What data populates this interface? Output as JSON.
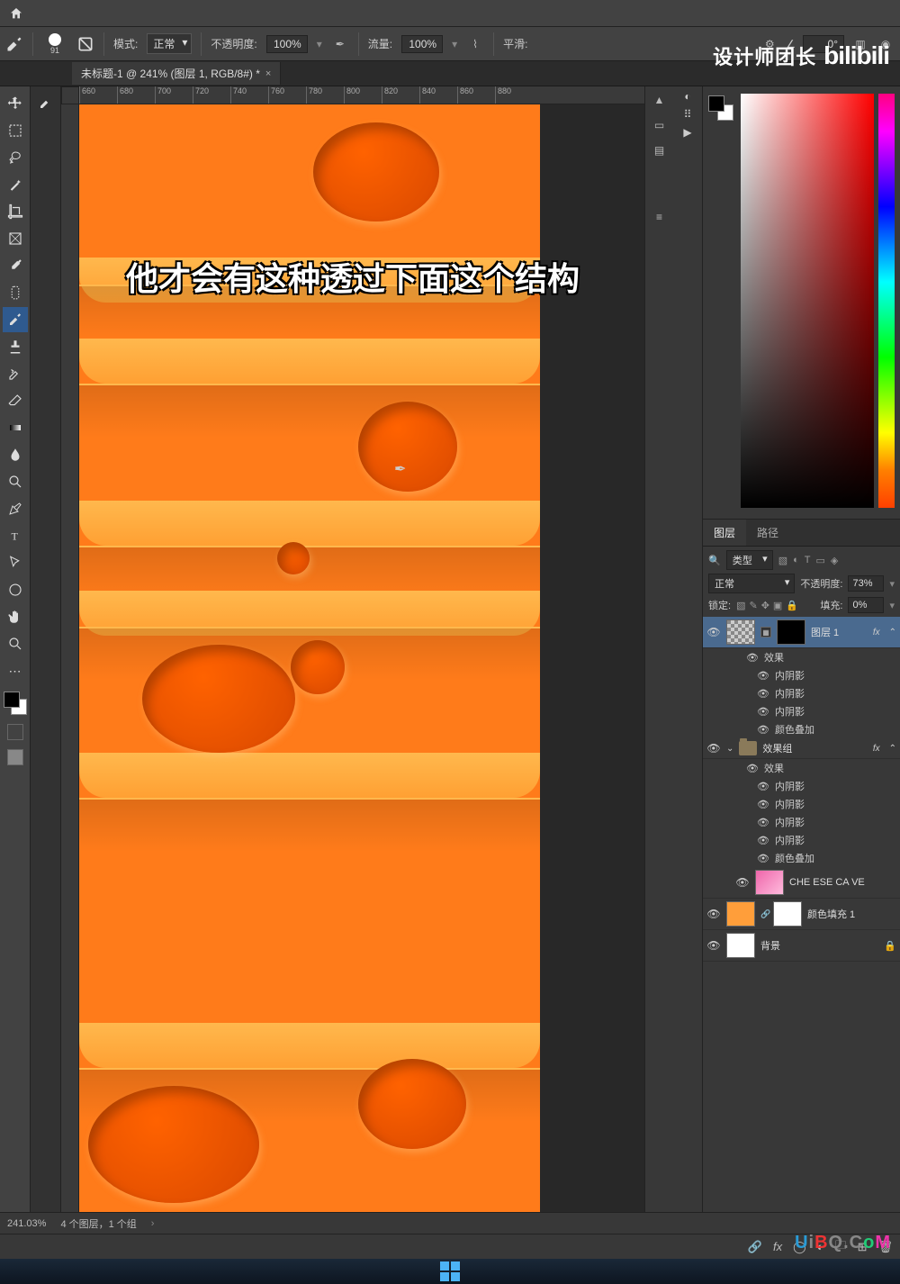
{
  "topbar": {
    "home": "⌂"
  },
  "options": {
    "brush_size": "91",
    "mode_label": "模式:",
    "mode_value": "正常",
    "opacity_label": "不透明度:",
    "opacity_value": "100%",
    "flow_label": "流量:",
    "flow_value": "100%",
    "smooth_label": "平滑:",
    "angle_label": "∠",
    "angle_value": "0°"
  },
  "doctab": {
    "title": "未标题-1 @ 241% (图层 1, RGB/8#) *"
  },
  "ruler_ticks": [
    "660",
    "680",
    "700",
    "720",
    "740",
    "760",
    "780",
    "800",
    "820",
    "840",
    "860",
    "880"
  ],
  "caption": "他才会有这种透过下面这个结构",
  "watermark_top": "设计师团长",
  "watermark_bili": "bilibili",
  "watermark_bottom": [
    "U",
    "i",
    "B",
    "Q",
    ".C",
    "o",
    "M"
  ],
  "panels": {
    "layers_tab": "图层",
    "paths_tab": "路径",
    "filter_label": "类型",
    "blend_mode": "正常",
    "opacity_label": "不透明度:",
    "opacity_value": "73%",
    "lock_label": "锁定:",
    "fill_label": "填充:",
    "fill_value": "0%"
  },
  "layers": {
    "layer1": "图层 1",
    "fx": "fx",
    "effects": "效果",
    "inner_shadow": "内阴影",
    "color_overlay": "颜色叠加",
    "group": "效果组",
    "cheese": "CHE ESE CA VE",
    "color_fill": "颜色填充 1",
    "background": "背景"
  },
  "status": {
    "zoom": "241.03%",
    "info": "4 个图层，1 个组"
  }
}
